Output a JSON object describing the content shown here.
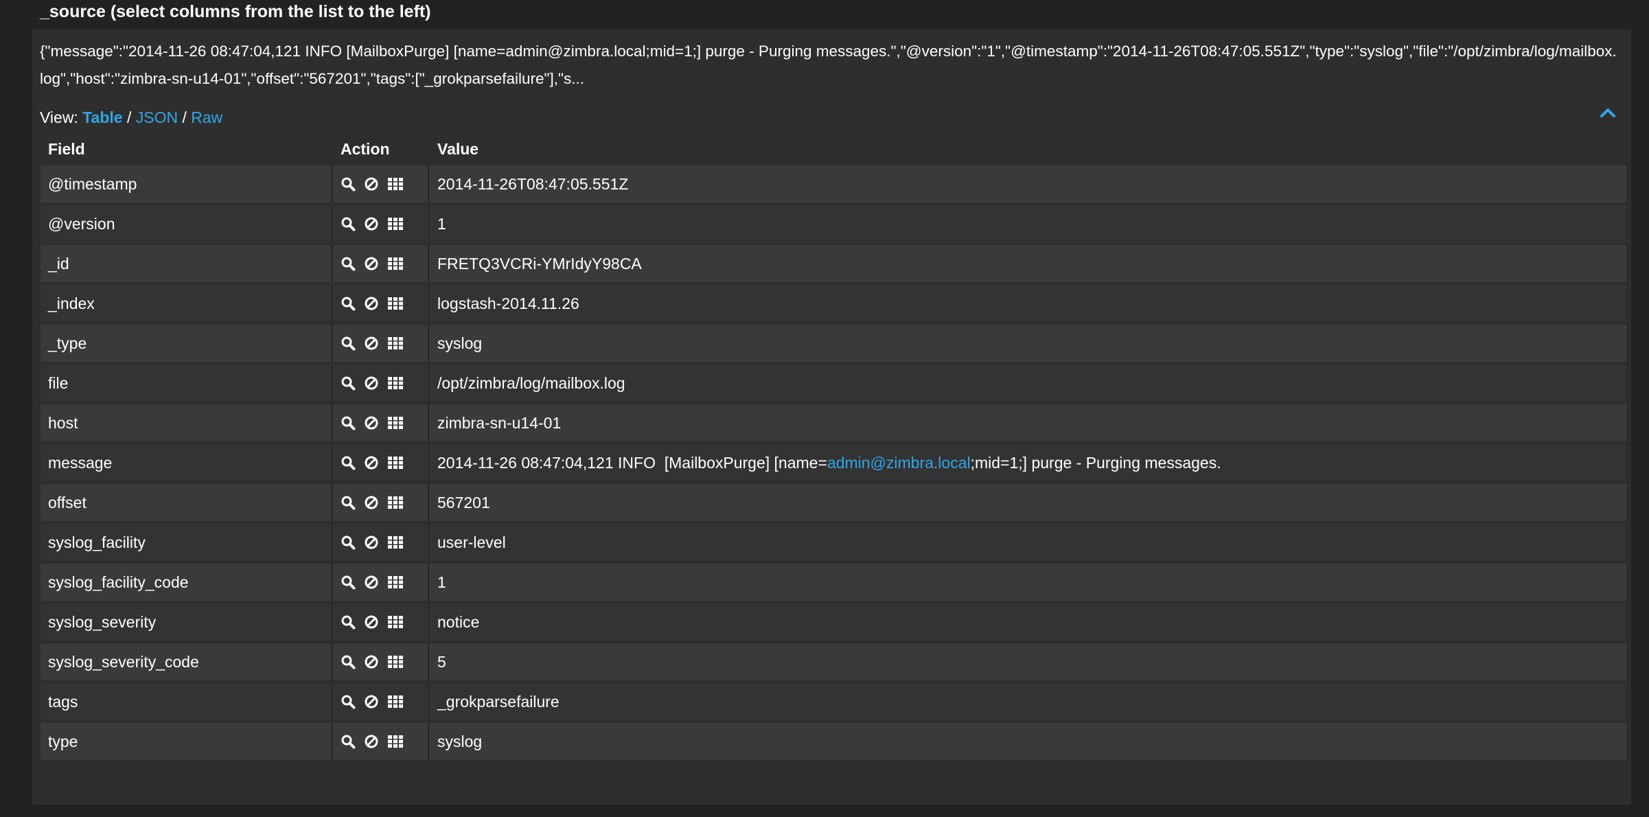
{
  "header": {
    "title": "_source (select columns from the list to the left)"
  },
  "source": {
    "text": "{\"message\":\"2014-11-26 08:47:04,121 INFO [MailboxPurge] [name=admin@zimbra.local;mid=1;] purge - Purging messages.\",\"@version\":\"1\",\"@timestamp\":\"2014-11-26T08:47:05.551Z\",\"type\":\"syslog\",\"file\":\"/opt/zimbra/log/mailbox.log\",\"host\":\"zimbra-sn-u14-01\",\"offset\":\"567201\",\"tags\":[\"_grokparsefailure\"],\"s..."
  },
  "view": {
    "prefix": "View:",
    "table": "Table",
    "sep1": " / ",
    "json": "JSON",
    "sep2": " / ",
    "raw": "Raw"
  },
  "columns": {
    "field": "Field",
    "action": "Action",
    "value": "Value"
  },
  "rows": [
    {
      "field": "@timestamp",
      "value": "2014-11-26T08:47:05.551Z"
    },
    {
      "field": "@version",
      "value": "1"
    },
    {
      "field": "_id",
      "value": "FRETQ3VCRi-YMrIdyY98CA"
    },
    {
      "field": "_index",
      "value": "logstash-2014.11.26"
    },
    {
      "field": "_type",
      "value": "syslog"
    },
    {
      "field": "file",
      "value": "/opt/zimbra/log/mailbox.log"
    },
    {
      "field": "host",
      "value": "zimbra-sn-u14-01"
    },
    {
      "field": "message",
      "value_pre": "2014-11-26 08:47:04,121 INFO  [MailboxPurge] [name=",
      "value_link": "admin@zimbra.local",
      "value_post": ";mid=1;] purge - Purging messages."
    },
    {
      "field": "offset",
      "value": "567201"
    },
    {
      "field": "syslog_facility",
      "value": "user-level"
    },
    {
      "field": "syslog_facility_code",
      "value": "1"
    },
    {
      "field": "syslog_severity",
      "value": "notice"
    },
    {
      "field": "syslog_severity_code",
      "value": "5"
    },
    {
      "field": "tags",
      "value": "_grokparsefailure"
    },
    {
      "field": "type",
      "value": "syslog"
    }
  ],
  "icons": {
    "action": [
      "search-icon",
      "exclude-icon",
      "toggle-column-icon"
    ],
    "collapse": "chevron-up-icon"
  },
  "colors": {
    "link": "#2fa6e6",
    "panel": "#2e2e2e",
    "row_light": "#3a3a3a",
    "row_dark": "#333333"
  }
}
